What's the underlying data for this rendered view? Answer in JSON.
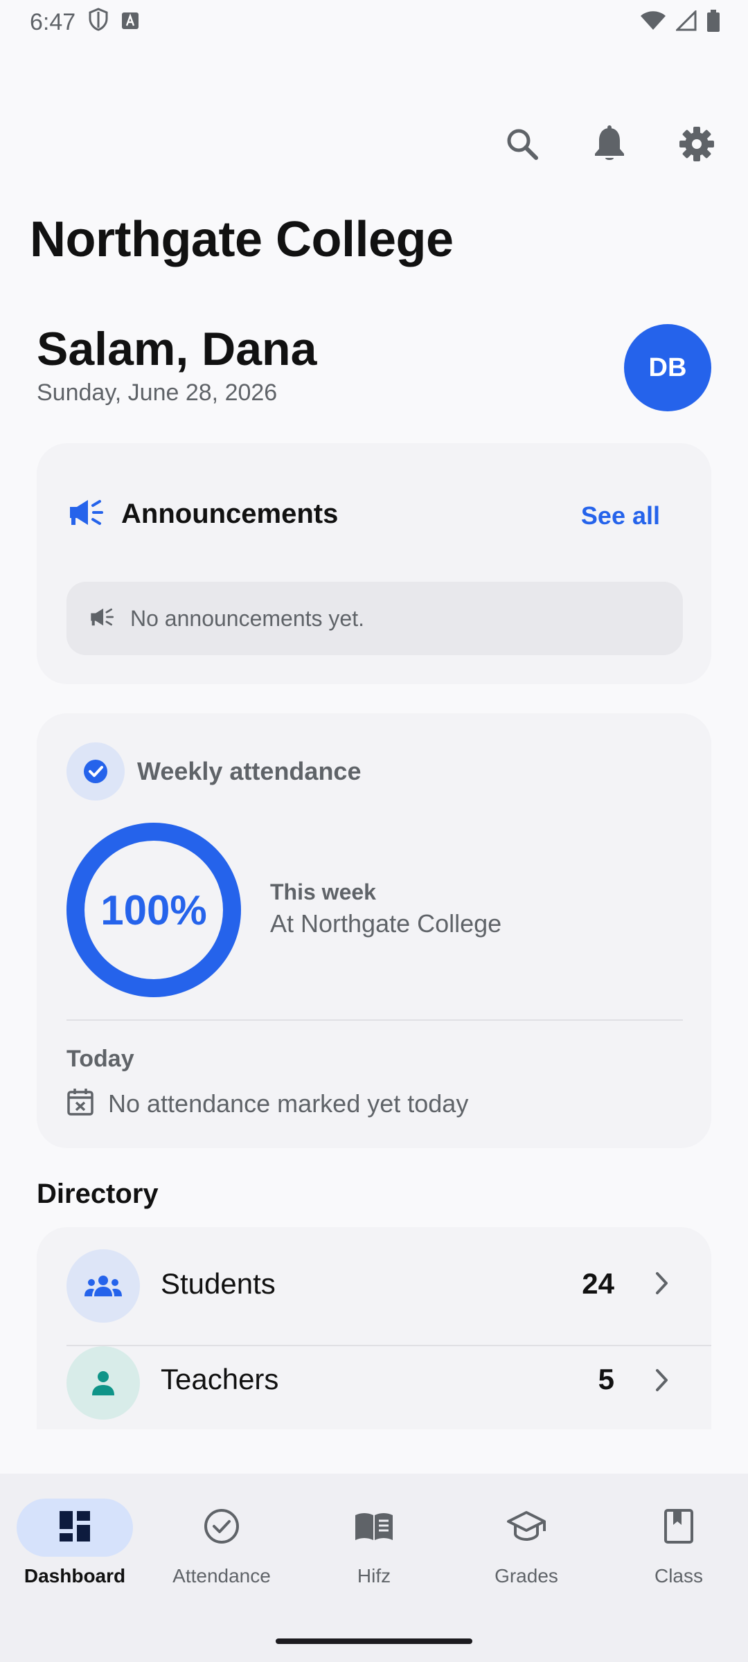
{
  "status_bar": {
    "time": "6:47"
  },
  "header": {
    "app_title": "Northgate College",
    "icons": [
      "search-icon",
      "bell-icon",
      "gear-icon"
    ]
  },
  "greeting": {
    "title": "Salam, Dana",
    "date": "Sunday, June 28, 2026",
    "avatar_initials": "DB"
  },
  "announcements": {
    "title": "Announcements",
    "see_all": "See all",
    "empty_text": "No announcements yet."
  },
  "attendance": {
    "title": "Weekly attendance",
    "percent_label": "100%",
    "percent_value": 1.0,
    "week_label": "This week",
    "week_sub": "At Northgate College",
    "today_label": "Today",
    "today_text": "No attendance marked yet today"
  },
  "directory": {
    "title": "Directory",
    "items": [
      {
        "label": "Students",
        "count": "24"
      },
      {
        "label": "Teachers",
        "count": "5"
      }
    ]
  },
  "bottom_nav": {
    "items": [
      {
        "label": "Dashboard"
      },
      {
        "label": "Attendance"
      },
      {
        "label": "Hifz"
      },
      {
        "label": "Grades"
      },
      {
        "label": "Class"
      }
    ],
    "active": "Dashboard"
  },
  "colors": {
    "accent": "#2563eb",
    "teal": "#0f9488"
  }
}
